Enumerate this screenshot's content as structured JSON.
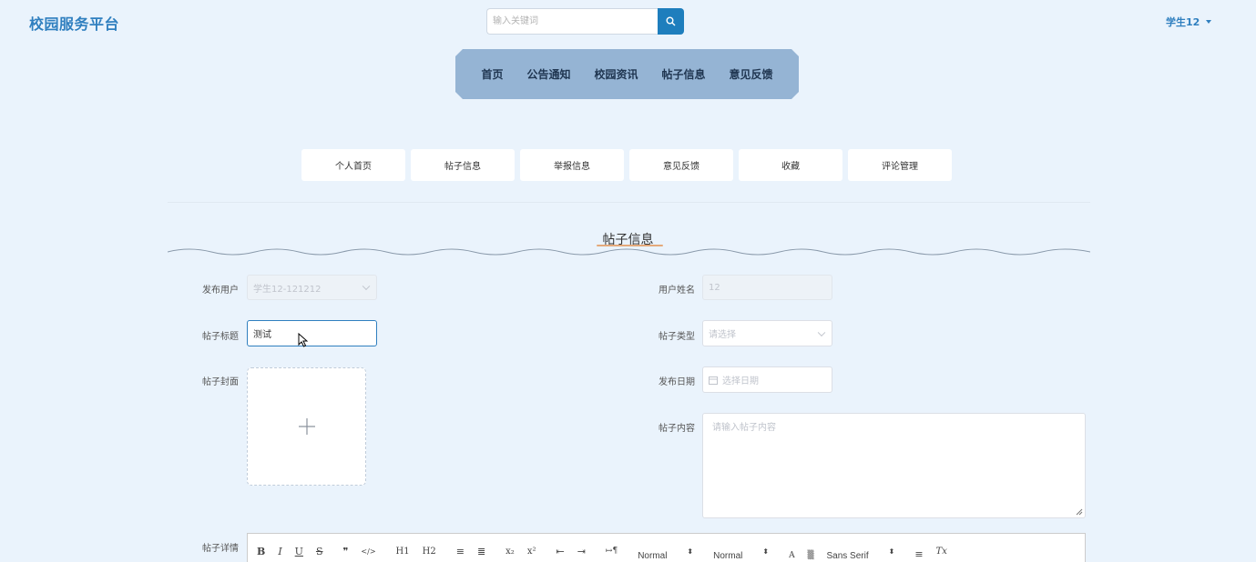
{
  "header": {
    "logo": "校园服务平台",
    "search_placeholder": "输入关键词",
    "user": "学生12"
  },
  "nav": [
    "首页",
    "公告通知",
    "校园资讯",
    "帖子信息",
    "意见反馈"
  ],
  "subnav": [
    "个人首页",
    "帖子信息",
    "举报信息",
    "意见反馈",
    "收藏",
    "评论管理"
  ],
  "section_title": "帖子信息",
  "form": {
    "publisher_label": "发布用户",
    "publisher_value": "学生12-121212",
    "username_label": "用户姓名",
    "username_value": "12",
    "title_label": "帖子标题",
    "title_value": "测试",
    "type_label": "帖子类型",
    "type_placeholder": "请选择",
    "cover_label": "帖子封面",
    "date_label": "发布日期",
    "date_placeholder": "选择日期",
    "content_label": "帖子内容",
    "content_placeholder": "请输入帖子内容",
    "detail_label": "帖子详情"
  },
  "toolbar": {
    "buttons": [
      "B",
      "I",
      "U",
      "S",
      "❞",
      "</>",
      "H1",
      "H2",
      "≡",
      "≣",
      "x₂",
      "x²",
      "⇤",
      "⇥",
      "↦¶"
    ],
    "size_select": "Normal",
    "header_select": "Normal",
    "font_select": "Sans Serif",
    "clear": "Tx"
  },
  "colors": {
    "accent": "#1e7ebd",
    "navbar": "#95b4d4",
    "background": "#eaf3fc"
  }
}
